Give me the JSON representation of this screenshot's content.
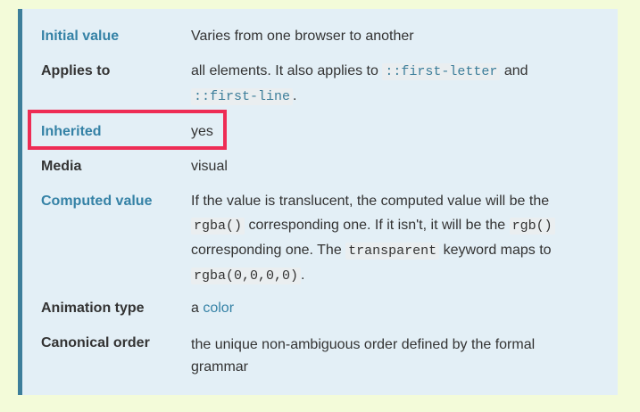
{
  "rows": {
    "initial": {
      "label": "Initial value",
      "value": "Varies from one browser to another"
    },
    "applies": {
      "label": "Applies to",
      "text1": "all elements. It also applies to ",
      "code1": "::first-letter",
      "text2": " and",
      "code2": "::first-line",
      "text3": "."
    },
    "inherited": {
      "label": "Inherited",
      "value": "yes"
    },
    "media": {
      "label": "Media",
      "value": "visual"
    },
    "computed": {
      "label": "Computed value",
      "text1": "If the value is translucent, the computed value will be the",
      "code1": "rgba()",
      "text2": " corresponding one. If it isn't, it will be the ",
      "code2": "rgb()",
      "text3": "corresponding one. The ",
      "code3": "transparent",
      "text4": " keyword maps to",
      "code4": "rgba(0,0,0,0)",
      "text5": "."
    },
    "animation": {
      "label": "Animation type",
      "prefix": "a ",
      "link": "color"
    },
    "canonical": {
      "label": "Canonical order",
      "value": "the unique non-ambiguous order defined by the formal grammar"
    }
  },
  "colors": {
    "page_bg": "#f3fbd9",
    "panel_bg": "#e3eff6",
    "accent_border": "#3d7e9a",
    "link": "#3582a6",
    "highlight": "#ee2c55"
  }
}
